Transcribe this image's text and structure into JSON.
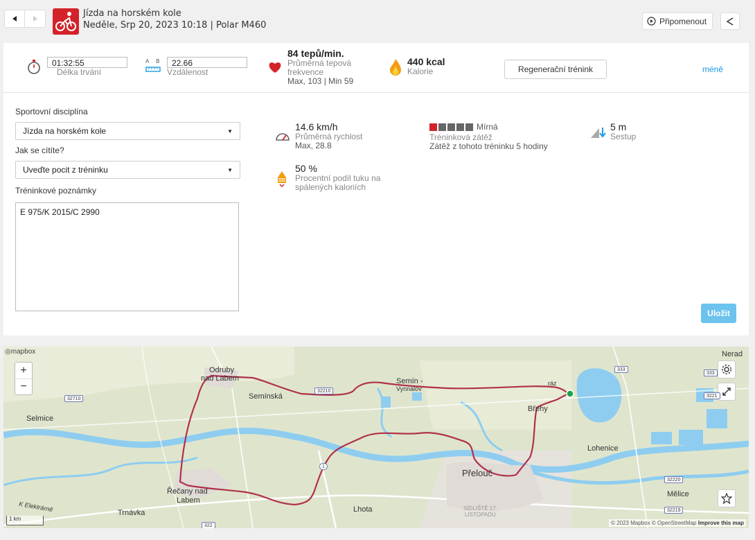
{
  "header": {
    "title": "Jízda na horském kole",
    "subtitle": "Neděle, Srp 20, 2023 10:18 | Polar M460",
    "remind_label": "Připomenout"
  },
  "summary": {
    "duration_value": "01:32:55",
    "duration_label": "Délka trvání",
    "distance_value": "22.66",
    "distance_label": "Vzdálenost",
    "distance_ab": "A B",
    "hr_value": "84 tepů/min.",
    "hr_label_1": "Průměrná tepová",
    "hr_label_2": "frekvence",
    "hr_minmax": "Max, 103  |  Min 59",
    "kcal_value": "440 kcal",
    "kcal_label": "Kalorie",
    "benefit_label": "Regenerační trénink",
    "less_label": "méně"
  },
  "form": {
    "sport_label": "Sportovní disciplína",
    "sport_value": "Jízda na horském kole",
    "feeling_label": "Jak se cítíte?",
    "feeling_value": "Uveďte pocit z tréninku",
    "notes_label": "Tréninkové poznámky",
    "notes_value": "E 975/K 2015/C 2990",
    "save_label": "Uložit"
  },
  "details": {
    "speed_value": "14.6 km/h",
    "speed_label": "Průměrná rychlost",
    "speed_max": "Max, 28.8",
    "fat_value": "50 %",
    "fat_label_1": "Procentní podíl tuku na",
    "fat_label_2": "spálených kaloriích",
    "load_level": "Mírná",
    "load_label": "Tréninková zátěž",
    "load_sub": "Zátěž z tohoto tréninku 5 hodiny",
    "load_filled": 1,
    "load_total": 5,
    "descent_value": "5 m",
    "descent_label": "Sestup"
  },
  "map": {
    "logo": "mapbox",
    "zoom_in": "+",
    "zoom_out": "−",
    "scale": "1 km",
    "attribution_1": "© 2023 Mapbox © OpenStreetMap",
    "attribution_2": "Improve this map",
    "labels": {
      "odruby": "Odruby",
      "nad_labem": "nad Labem",
      "seminska": "Semínská",
      "semin": "Semín -",
      "vynnalov": "Vynnalov",
      "selmice": "Selmice",
      "brehy": "Břehy",
      "lohenice": "Lohenice",
      "recany": "Řečany nad",
      "recany2": "Labem",
      "lhota": "Lhota",
      "trnavka": "Trnávka",
      "prelouc": "Přelouč",
      "sidliste": "SÍDLIŠTĚ 17.",
      "listopadu": "LISTOPADU",
      "melice": "Mělice",
      "nerad": "Nerad",
      "elektrarna": "K Elektrárně",
      "raz": "ráz"
    },
    "roads": {
      "r32710": "32710",
      "r32210": "32210",
      "r333a": "333",
      "r333b": "333",
      "r3221": "3221",
      "r32220": "32220",
      "r32219": "32219",
      "r322": "322",
      "r1": "1"
    }
  },
  "colors": {
    "accent_red": "#d3222a",
    "link_blue": "#1a9be0",
    "save_blue": "#6bc3ee",
    "route": "#b0304a"
  }
}
